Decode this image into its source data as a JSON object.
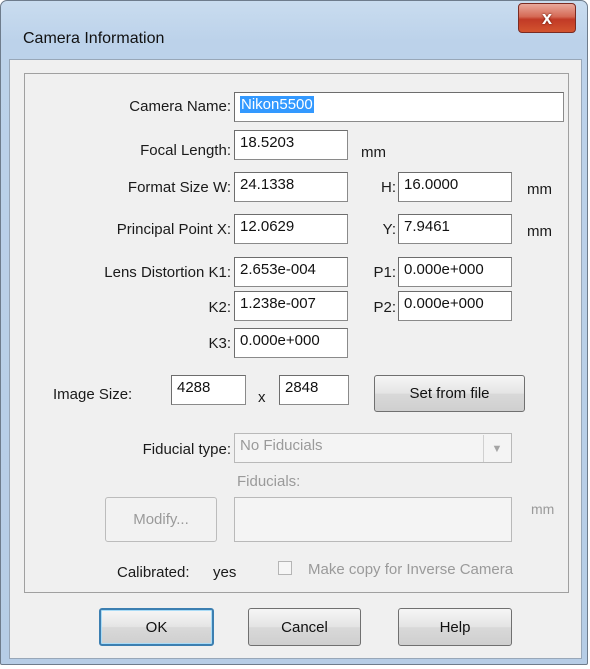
{
  "window": {
    "title": "Camera Information",
    "close_glyph": "x"
  },
  "camera_name": {
    "label": "Camera Name:",
    "value": "Nikon5500"
  },
  "focal_length": {
    "label": "Focal Length:",
    "value": "18.5203",
    "unit": "mm"
  },
  "format_size": {
    "label": "Format Size  W:",
    "w_value": "24.1338",
    "h_label": "H:",
    "h_value": "16.0000",
    "unit": "mm"
  },
  "principal_point": {
    "label": "Principal Point  X:",
    "x_value": "12.0629",
    "y_label": "Y:",
    "y_value": "7.9461",
    "unit": "mm"
  },
  "lens_distortion": {
    "label": "Lens Distortion  K1:",
    "k1_value": "2.653e-004",
    "p1_label": "P1:",
    "p1_value": "0.000e+000",
    "k2_label": "K2:",
    "k2_value": "1.238e-007",
    "p2_label": "P2:",
    "p2_value": "0.000e+000",
    "k3_label": "K3:",
    "k3_value": "0.000e+000"
  },
  "image_size": {
    "label": "Image Size:",
    "width": "4288",
    "times": "x",
    "height": "2848",
    "set_button": "Set from file"
  },
  "fiducial": {
    "type_label": "Fiducial type:",
    "type_value": "No Fiducials",
    "fiducials_label": "Fiducials:",
    "modify_button": "Modify...",
    "unit": "mm"
  },
  "calibrated": {
    "label": "Calibrated:",
    "value": "yes",
    "inverse_checkbox_label": "Make copy for Inverse Camera",
    "inverse_checked": false
  },
  "buttons": {
    "ok": "OK",
    "cancel": "Cancel",
    "help": "Help"
  }
}
